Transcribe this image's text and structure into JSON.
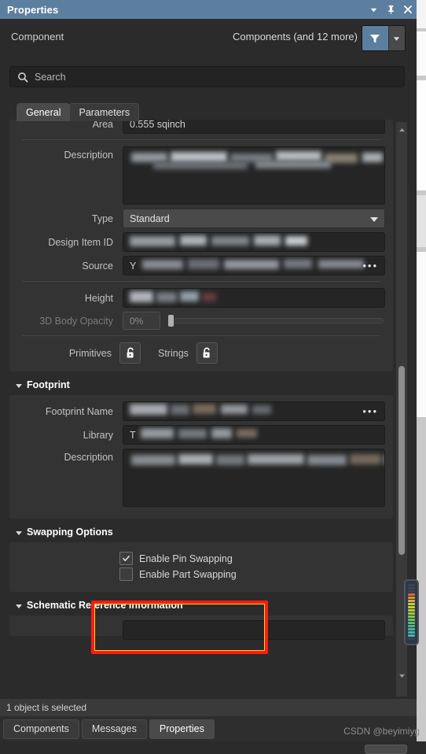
{
  "window": {
    "title": "Properties",
    "buttons": [
      {
        "name": "dropdown",
        "glyph": "▼"
      },
      {
        "name": "pin",
        "glyph": "⚓"
      },
      {
        "name": "close",
        "glyph": "✕"
      }
    ]
  },
  "header": {
    "object_label": "Component",
    "selection_summary": "Components (and 12 more)",
    "filter_icon": "filter-icon",
    "filter_dropdown_icon": "chevron-down-icon"
  },
  "search": {
    "placeholder": "Search",
    "value": "",
    "icon": "search-icon"
  },
  "tabs": [
    {
      "label": "General",
      "active": true
    },
    {
      "label": "Parameters",
      "active": false
    }
  ],
  "general": {
    "area": {
      "label": "Area",
      "value": "0.555 sqinch"
    },
    "description": {
      "label": "Description",
      "value": "",
      "redacted": true
    },
    "type": {
      "label": "Type",
      "value": "Standard"
    },
    "design_item_id": {
      "label": "Design Item ID",
      "value": "",
      "redacted": true
    },
    "source": {
      "label": "Source",
      "value": "Y",
      "redacted": true,
      "browse": "•••"
    },
    "height": {
      "label": "Height",
      "value": "",
      "redacted": true
    },
    "opacity": {
      "label": "3D Body Opacity",
      "value": "0%",
      "slider_percent": 0
    },
    "primitives": {
      "label": "Primitives",
      "icon": "unlock-icon"
    },
    "strings": {
      "label": "Strings",
      "icon": "unlock-icon"
    }
  },
  "footprint": {
    "title": "Footprint",
    "name": {
      "label": "Footprint Name",
      "value": "",
      "redacted": true,
      "browse": "•••"
    },
    "library": {
      "label": "Library",
      "value": "T",
      "redacted": true
    },
    "description": {
      "label": "Description",
      "value": "",
      "redacted": true
    }
  },
  "swapping": {
    "title": "Swapping Options",
    "options": [
      {
        "label": "Enable Pin Swapping",
        "checked": true
      },
      {
        "label": "Enable Part Swapping",
        "checked": false
      }
    ],
    "highlight": {
      "outer_color": "#fb1c16",
      "inner_color": "#f7d117"
    }
  },
  "schematic": {
    "title": "Schematic Reference Information"
  },
  "status": {
    "text": "1 object is selected"
  },
  "bottom_tabs": [
    {
      "label": "Components",
      "active": false
    },
    {
      "label": "Messages",
      "active": false
    },
    {
      "label": "Properties",
      "active": true
    }
  ],
  "watermark": {
    "text": "CSDN @beyimiyg"
  },
  "layer_strip": {
    "name": "layer-color-strip",
    "colors": [
      "#3a4450",
      "#3a4450",
      "#3a4450",
      "#d86a3a",
      "#d8933a",
      "#d6b23a",
      "#d4c63a",
      "#c9cf3c",
      "#b6cd3e",
      "#9fc93f",
      "#87c54b",
      "#6fc05e",
      "#5bbc72",
      "#4cb888",
      "#45b79c",
      "#42b6ad",
      "#3fb3bd",
      "#3b4350"
    ]
  },
  "theme": {
    "titlebar": "#5d7f9f",
    "panel_bg": "#2b2b2b",
    "group_bg": "#333333",
    "field_bg": "#252525",
    "accent": "#5d7f9f"
  }
}
